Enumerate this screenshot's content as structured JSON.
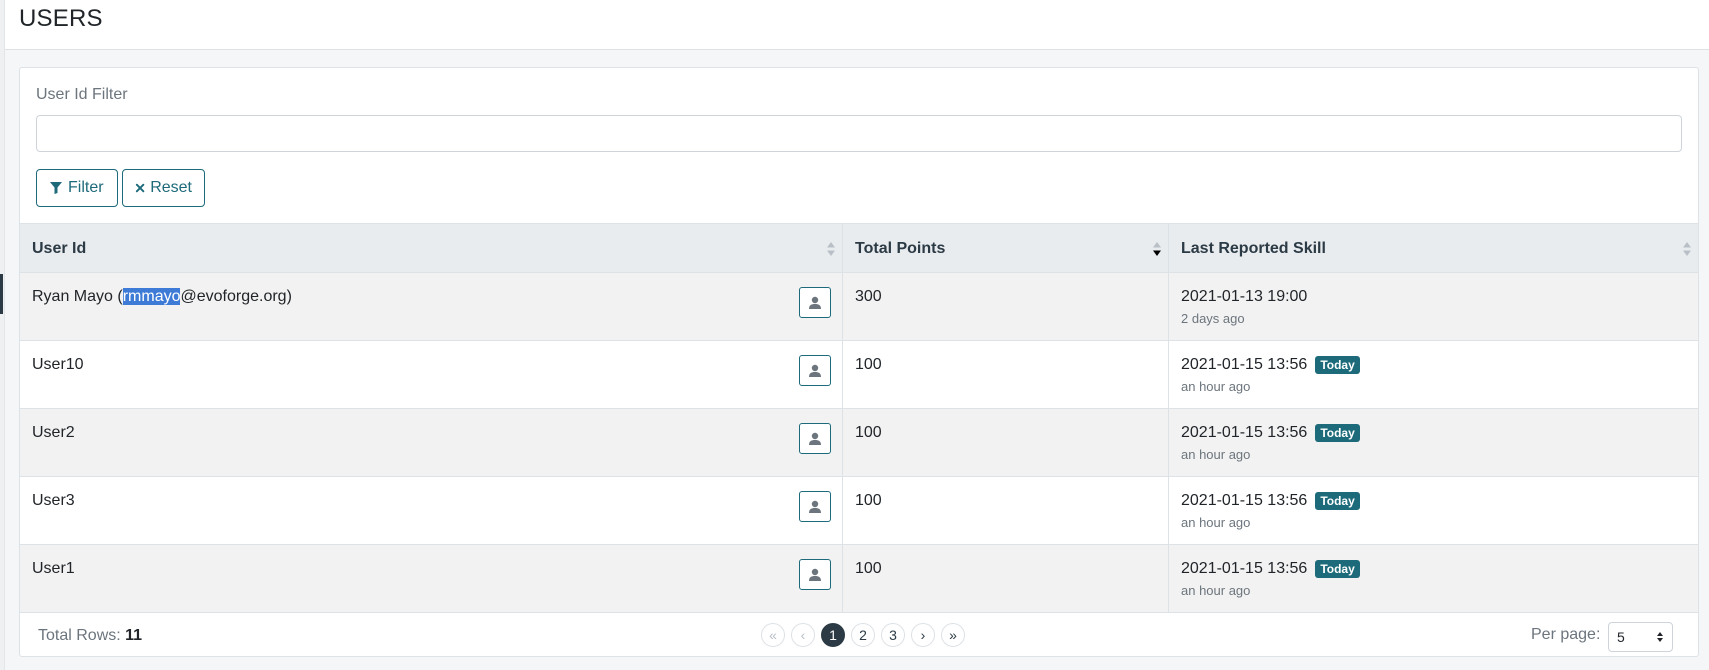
{
  "header": {
    "title": "USERS"
  },
  "filter": {
    "label": "User Id Filter",
    "value": "",
    "filter_button": "Filter",
    "reset_button": "Reset"
  },
  "table": {
    "columns": [
      "User Id",
      "Total Points",
      "Last Reported Skill"
    ],
    "rows": [
      {
        "user_prefix": "Ryan Mayo (",
        "user_selected": "rmmayo",
        "user_suffix": "@evoforge.org)",
        "points": "300",
        "date": "2021-01-13 19:00",
        "badge": "",
        "ago": "2 days ago"
      },
      {
        "user_prefix": "User10",
        "user_selected": "",
        "user_suffix": "",
        "points": "100",
        "date": "2021-01-15 13:56",
        "badge": "Today",
        "ago": "an hour ago"
      },
      {
        "user_prefix": "User2",
        "user_selected": "",
        "user_suffix": "",
        "points": "100",
        "date": "2021-01-15 13:56",
        "badge": "Today",
        "ago": "an hour ago"
      },
      {
        "user_prefix": "User3",
        "user_selected": "",
        "user_suffix": "",
        "points": "100",
        "date": "2021-01-15 13:56",
        "badge": "Today",
        "ago": "an hour ago"
      },
      {
        "user_prefix": "User1",
        "user_selected": "",
        "user_suffix": "",
        "points": "100",
        "date": "2021-01-15 13:56",
        "badge": "Today",
        "ago": "an hour ago"
      }
    ]
  },
  "footer": {
    "total_rows_label": "Total Rows:",
    "total_rows_value": "11",
    "pager": {
      "first": "«",
      "prev": "‹",
      "pages": [
        "1",
        "2",
        "3"
      ],
      "active_page": "1",
      "next": "›",
      "last": "»"
    },
    "per_page_label": "Per page:",
    "per_page_value": "5"
  },
  "colors": {
    "accent": "#1d6a7a",
    "dark": "#2b3a44",
    "selection": "#3d7bd6"
  }
}
